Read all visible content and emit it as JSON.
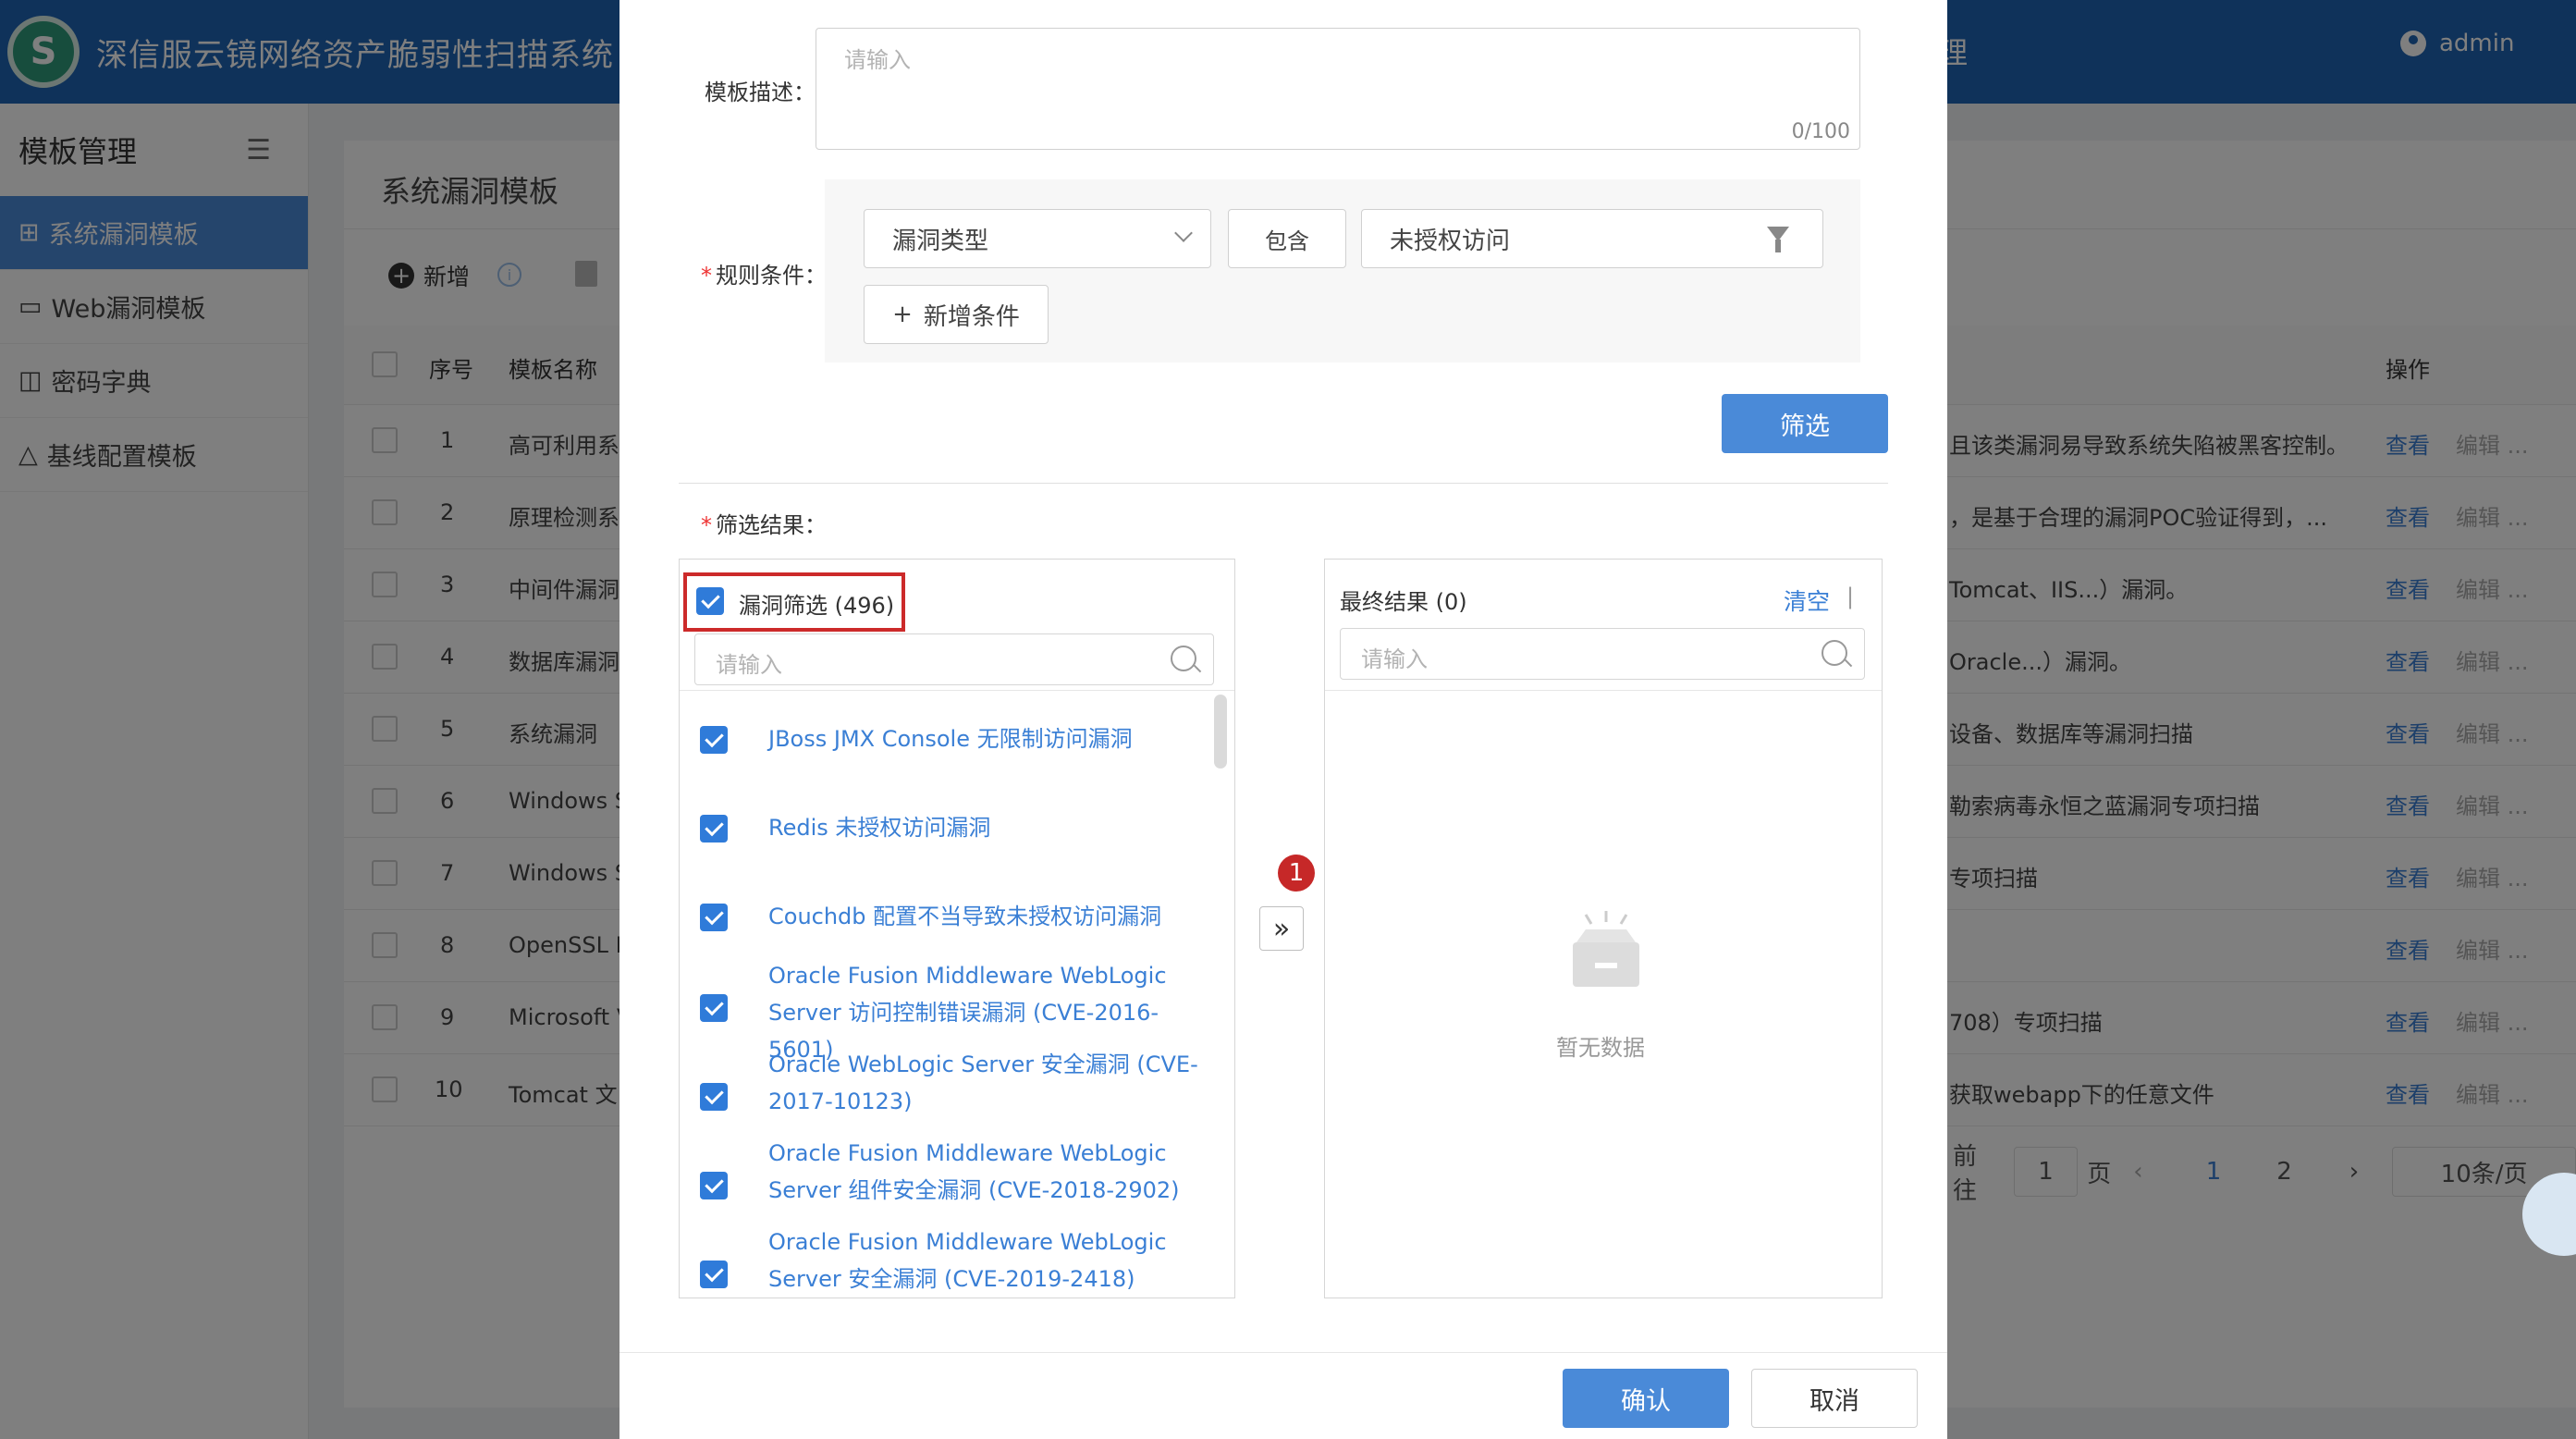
{
  "app": {
    "title": "深信服云镜网络资产脆弱性扫描系统",
    "logo_letter": "S",
    "nav_tail": "理",
    "user": "admin"
  },
  "sidebar": {
    "header": "模板管理",
    "items": [
      {
        "icon": "⊞",
        "label": "系统漏洞模板"
      },
      {
        "icon": "▭",
        "label": "Web漏洞模板"
      },
      {
        "icon": "◫",
        "label": "密码字典"
      },
      {
        "icon": "△",
        "label": "基线配置模板"
      }
    ]
  },
  "page": {
    "title": "系统漏洞模板",
    "toolbar": {
      "add": "新增",
      "info": "i"
    },
    "table": {
      "headers": {
        "index": "序号",
        "name": "模板名称",
        "action": "操作"
      },
      "rows": [
        {
          "idx": "1",
          "name": "高可利用系",
          "desc": "且该类漏洞易导致系统失陷被黑客控制。"
        },
        {
          "idx": "2",
          "name": "原理检测系",
          "desc": "，是基于合理的漏洞POC验证得到，..."
        },
        {
          "idx": "3",
          "name": "中间件漏洞",
          "desc": "Tomcat、IIS...）漏洞。"
        },
        {
          "idx": "4",
          "name": "数据库漏洞",
          "desc": "Oracle...）漏洞。"
        },
        {
          "idx": "5",
          "name": "系统漏洞",
          "desc": "设备、数据库等漏洞扫描"
        },
        {
          "idx": "6",
          "name": "Windows S",
          "desc": "勒索病毒永恒之蓝漏洞专项扫描"
        },
        {
          "idx": "7",
          "name": "Windows S",
          "desc": "专项扫描"
        },
        {
          "idx": "8",
          "name": "OpenSSL H",
          "desc": ""
        },
        {
          "idx": "9",
          "name": "Microsoft V",
          "desc": "708）专项扫描"
        },
        {
          "idx": "10",
          "name": "Tomcat 文",
          "desc": "获取webapp下的任意文件"
        }
      ],
      "view_label": "查看",
      "edit_label": "编辑 ..."
    },
    "pagination": {
      "goto": "前往",
      "page_value": "1",
      "page_suffix": "页",
      "prev": "‹",
      "pages": [
        "1",
        "2"
      ],
      "next": "›",
      "per_page": "10条/页"
    }
  },
  "dialog": {
    "desc_label": "模板描述：",
    "desc_placeholder": "请输入",
    "desc_count": "0/100",
    "rule_label": "规则条件：",
    "rule": {
      "field": "漏洞类型",
      "op": "包含",
      "value": "未授权访问"
    },
    "add_condition": "新增条件",
    "filter_button": "筛选",
    "result_label": "筛选结果：",
    "source": {
      "title": "漏洞筛选 (496)",
      "search_placeholder": "请输入",
      "items": [
        "JBoss JMX Console 无限制访问漏洞",
        "Redis 未授权访问漏洞",
        "Couchdb 配置不当导致未授权访问漏洞",
        "Oracle Fusion Middleware WebLogic Server 访问控制错误漏洞 (CVE-2016-5601)",
        "Oracle WebLogic Server 安全漏洞 (CVE-2017-10123)",
        "Oracle Fusion Middleware WebLogic Server 组件安全漏洞 (CVE-2018-2902)",
        "Oracle Fusion Middleware WebLogic Server 安全漏洞 (CVE-2019-2418)"
      ]
    },
    "transfer_symbol": "»",
    "badge": "1",
    "target": {
      "title": "最终结果 (0)",
      "clear": "清空",
      "search_placeholder": "请输入",
      "empty_text": "暂无数据"
    },
    "confirm": "确认",
    "cancel": "取消"
  }
}
